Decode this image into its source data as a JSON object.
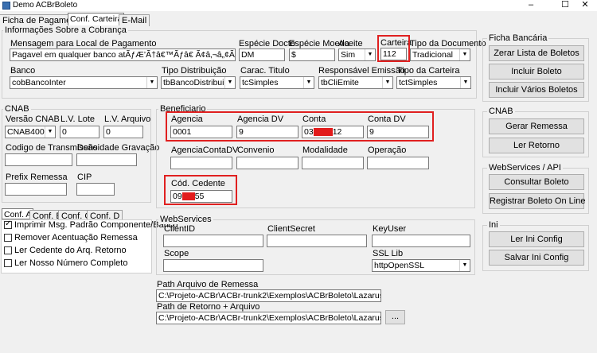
{
  "window": {
    "title": "Demo ACBrBoleto",
    "minimize": "–",
    "maximize": "☐",
    "close": "✕"
  },
  "main_tabs": [
    "Ficha de Pagamento",
    "Conf. Carteira",
    "E-Mail"
  ],
  "cobranca": {
    "title": "Informações Sobre a Cobrança",
    "mensagem_label": "Mensagem para Local de Pagamento",
    "mensagem_value": "Pagavel em qualquer banco atÃƒÆ’Ã†â€™Ãƒâ€ Ã¢â‚¬â„¢ÃƒÆ’Ã¢â‚¬Â ÃƒÂ¢Ã¢â€šÂ¬Ã¢â€žÂ¢Ã",
    "especie_docto_label": "Espécie Docto",
    "especie_docto_value": "DM",
    "especie_moeda_label": "Espécie Moeda",
    "especie_moeda_value": "$",
    "aceite_label": "Aceite",
    "aceite_value": "Sim",
    "carteira_label": "Carteira",
    "carteira_value": "112",
    "tipo_documento_label": "Tipo da Documento",
    "tipo_documento_value": "Tradicional",
    "banco_label": "Banco",
    "banco_value": "cobBancoInter",
    "tipo_distribuicao_label": "Tipo Distribuição",
    "tipo_distribuicao_value": "tbBancoDistribui",
    "carac_titulo_label": "Carac. Titulo",
    "carac_titulo_value": "tcSimples",
    "responsavel_label": "Responsável Emissão",
    "responsavel_value": "tbCliEmite",
    "tipo_carteira_label": "Tipo da Carteira",
    "tipo_carteira_value": "tctSimples"
  },
  "ficha_bancaria": {
    "title": "Ficha Bancária",
    "buttons": [
      "Zerar Lista de Boletos",
      "Incluir Boleto",
      "Incluir Vários Boletos"
    ]
  },
  "cnab_right": {
    "title": "CNAB",
    "buttons": [
      "Gerar Remessa",
      "Ler Retorno"
    ]
  },
  "webservices_right": {
    "title": "WebServices / API",
    "buttons": [
      "Consultar Boleto",
      "Registrar Boleto On Line"
    ]
  },
  "ini": {
    "title": "Ini",
    "buttons": [
      "Ler Ini Config",
      "Salvar Ini Config"
    ]
  },
  "cnab_left": {
    "title": "CNAB",
    "versao_label": "Versão CNAB",
    "versao_value": "CNAB400",
    "lv_lote_label": "L.V. Lote",
    "lv_lote_value": "0",
    "lv_arquivo_label": "L.V. Arquivo",
    "lv_arquivo_value": "0",
    "codigo_transmissao_label": "Codigo de Transmissão",
    "densidade_label": "Densidade Gravação",
    "prefix_remessa_label": "Prefix Remessa",
    "cip_label": "CIP"
  },
  "beneficiario": {
    "title": "Beneficiario",
    "agencia_label": "Agencia",
    "agencia_value": "0001",
    "agencia_dv_label": "Agencia DV",
    "agencia_dv_value": "9",
    "conta_label": "Conta",
    "conta_prefix": "03",
    "conta_suffix": "12",
    "conta_dv_label": "Conta DV",
    "conta_dv_value": "9",
    "agencia_conta_dv_label": "AgenciaContaDV",
    "convenio_label": "Convenio",
    "modalidade_label": "Modalidade",
    "operacao_label": "Operação",
    "cod_cedente_label": "Cód. Cedente",
    "cod_cedente_prefix": "09",
    "cod_cedente_suffix": "55"
  },
  "conf_tabs": [
    "Conf. A",
    "Conf. B",
    "Conf. C",
    "Conf. D"
  ],
  "conf_options": [
    {
      "label": "Imprimir Msg. Padrão Componente/Banco",
      "checked": true
    },
    {
      "label": "Remover Acentuação Remessa",
      "checked": false
    },
    {
      "label": "Ler Cedente do Arq. Retorno",
      "checked": false
    },
    {
      "label": "Ler Nosso Número Completo",
      "checked": false
    }
  ],
  "webservices": {
    "title": "WebServices",
    "client_id_label": "ClientID",
    "client_secret_label": "ClientSecret",
    "key_user_label": "KeyUser",
    "scope_label": "Scope",
    "ssl_lib_label": "SSL Lib",
    "ssl_lib_value": "httpOpenSSL"
  },
  "paths": {
    "remessa_label": "Path Arquivo de Remessa",
    "remessa_value": "C:\\Projeto-ACBr\\ACBr-trunk2\\Exemplos\\ACBrBoleto\\Lazarus\\lib\\i386-win3",
    "retorno_label": "Path de Retorno + Arquivo",
    "retorno_value": "C:\\Projeto-ACBr\\ACBr-trunk2\\Exemplos\\ACBrBoleto\\Lazarus\\lib\\i386-win3",
    "browse_label": "..."
  }
}
